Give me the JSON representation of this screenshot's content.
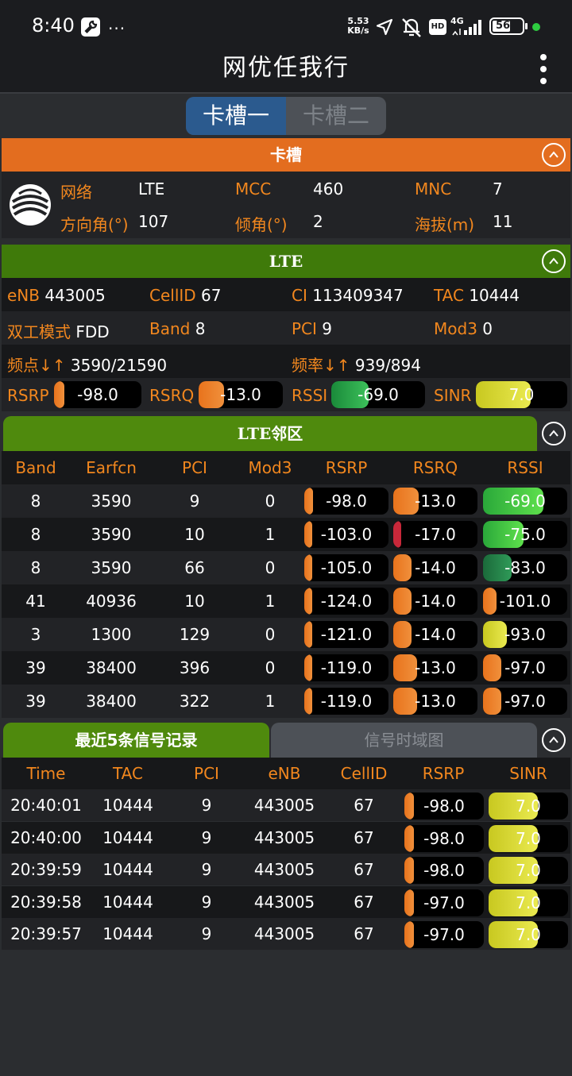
{
  "status_bar": {
    "time": "8:40",
    "net_speed": "5.53",
    "net_unit": "KB/s",
    "hd": "HD",
    "net_type": "4G",
    "battery": "56"
  },
  "app_bar": {
    "title": "网优任我行"
  },
  "sim_tabs": [
    "卡槽一",
    "卡槽二"
  ],
  "slot": {
    "header": "卡槽",
    "labels": [
      "网络",
      "MCC",
      "MNC",
      "方向角(°)",
      "倾角(°)",
      "海拔(m)"
    ],
    "values": [
      "LTE",
      "460",
      "7",
      "107",
      "2",
      "11"
    ]
  },
  "lte": {
    "header": "LTE",
    "row1": [
      "eNB",
      "443005",
      "CellID",
      "67",
      "CI",
      "113409347",
      "TAC",
      "10444"
    ],
    "row2": [
      "双工模式",
      "FDD",
      "Band",
      "8",
      "PCI",
      "9",
      "Mod3",
      "0"
    ],
    "row3": [
      "频点↓↑",
      "3590/21590",
      "频率↓↑",
      "939/894"
    ],
    "metrics": [
      {
        "label": "RSRP",
        "value": "-98.0",
        "fill": 0.12,
        "color": "orange"
      },
      {
        "label": "RSRQ",
        "value": "-13.0",
        "fill": 0.3,
        "color": "orange"
      },
      {
        "label": "RSSI",
        "value": "-69.0",
        "fill": 0.4,
        "color": "green"
      },
      {
        "label": "SINR",
        "value": "7.0",
        "fill": 0.6,
        "color": "yellow"
      }
    ]
  },
  "neighbors": {
    "header": "LTE邻区",
    "columns": [
      "Band",
      "Earfcn",
      "PCI",
      "Mod3",
      "RSRP",
      "RSRQ",
      "RSSI"
    ],
    "rows": [
      {
        "band": "8",
        "earfcn": "3590",
        "pci": "9",
        "mod3": "0",
        "rsrp": "-98.0",
        "rsrp_fill": 0.1,
        "rsrp_color": "orange",
        "rsrq": "-13.0",
        "rsrq_fill": 0.3,
        "rsrq_color": "orange",
        "rssi": "-69.0",
        "rssi_fill": 0.72,
        "rssi_color": "brightgreen"
      },
      {
        "band": "8",
        "earfcn": "3590",
        "pci": "10",
        "mod3": "1",
        "rsrp": "-103.0",
        "rsrp_fill": 0.06,
        "rsrp_color": "orange",
        "rsrq": "-17.0",
        "rsrq_fill": 0.05,
        "rsrq_color": "red",
        "rssi": "-75.0",
        "rssi_fill": 0.48,
        "rssi_color": "brightgreen"
      },
      {
        "band": "8",
        "earfcn": "3590",
        "pci": "66",
        "mod3": "0",
        "rsrp": "-105.0",
        "rsrp_fill": 0.05,
        "rsrp_color": "orange",
        "rsrq": "-14.0",
        "rsrq_fill": 0.22,
        "rsrq_color": "orange",
        "rssi": "-83.0",
        "rssi_fill": 0.34,
        "rssi_color": "darkgreen"
      },
      {
        "band": "41",
        "earfcn": "40936",
        "pci": "10",
        "mod3": "1",
        "rsrp": "-124.0",
        "rsrp_fill": 0.0,
        "rsrp_color": "orange",
        "rsrq": "-14.0",
        "rsrq_fill": 0.22,
        "rsrq_color": "orange",
        "rssi": "-101.0",
        "rssi_fill": 0.16,
        "rssi_color": "orange"
      },
      {
        "band": "3",
        "earfcn": "1300",
        "pci": "129",
        "mod3": "0",
        "rsrp": "-121.0",
        "rsrp_fill": 0.0,
        "rsrp_color": "orange",
        "rsrq": "-14.0",
        "rsrq_fill": 0.22,
        "rsrq_color": "orange",
        "rssi": "-93.0",
        "rssi_fill": 0.28,
        "rssi_color": "yellow"
      },
      {
        "band": "39",
        "earfcn": "38400",
        "pci": "396",
        "mod3": "0",
        "rsrp": "-119.0",
        "rsrp_fill": 0.0,
        "rsrp_color": "orange",
        "rsrq": "-13.0",
        "rsrq_fill": 0.28,
        "rsrq_color": "orange",
        "rssi": "-97.0",
        "rssi_fill": 0.22,
        "rssi_color": "orange"
      },
      {
        "band": "39",
        "earfcn": "38400",
        "pci": "322",
        "mod3": "1",
        "rsrp": "-119.0",
        "rsrp_fill": 0.0,
        "rsrp_color": "orange",
        "rsrq": "-13.0",
        "rsrq_fill": 0.28,
        "rsrq_color": "orange",
        "rssi": "-97.0",
        "rssi_fill": 0.22,
        "rssi_color": "orange"
      }
    ]
  },
  "records": {
    "tabs": [
      "最近5条信号记录",
      "信号时域图"
    ],
    "columns": [
      "Time",
      "TAC",
      "PCI",
      "eNB",
      "CellID",
      "RSRP",
      "SINR"
    ],
    "rows": [
      {
        "time": "20:40:01",
        "tac": "10444",
        "pci": "9",
        "enb": "443005",
        "cellid": "67",
        "rsrp": "-98.0",
        "rsrp_fill": 0.12,
        "sinr": "7.0",
        "sinr_fill": 0.62
      },
      {
        "time": "20:40:00",
        "tac": "10444",
        "pci": "9",
        "enb": "443005",
        "cellid": "67",
        "rsrp": "-98.0",
        "rsrp_fill": 0.12,
        "sinr": "7.0",
        "sinr_fill": 0.62
      },
      {
        "time": "20:39:59",
        "tac": "10444",
        "pci": "9",
        "enb": "443005",
        "cellid": "67",
        "rsrp": "-98.0",
        "rsrp_fill": 0.12,
        "sinr": "7.0",
        "sinr_fill": 0.62
      },
      {
        "time": "20:39:58",
        "tac": "10444",
        "pci": "9",
        "enb": "443005",
        "cellid": "67",
        "rsrp": "-97.0",
        "rsrp_fill": 0.12,
        "sinr": "7.0",
        "sinr_fill": 0.62
      },
      {
        "time": "20:39:57",
        "tac": "10444",
        "pci": "9",
        "enb": "443005",
        "cellid": "67",
        "rsrp": "-97.0",
        "rsrp_fill": 0.12,
        "sinr": "7.0",
        "sinr_fill": 0.62
      }
    ]
  },
  "colors": {
    "orange": "#f07c22",
    "green_header": "#4f8a0d",
    "lte_header": "#3f7a0a",
    "sim_active": "#2b5a8e"
  }
}
